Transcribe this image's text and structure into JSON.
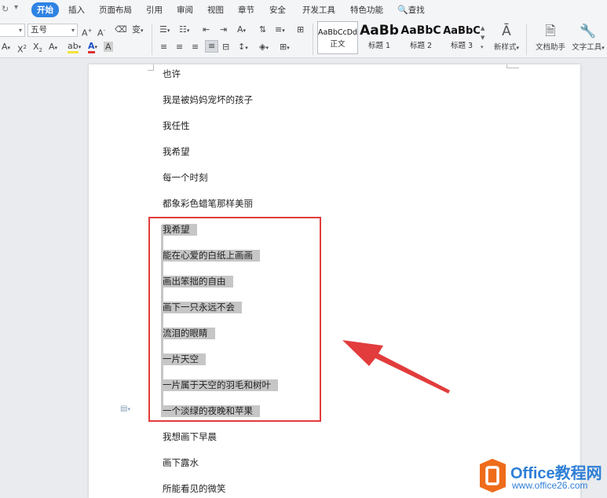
{
  "menubar": {
    "undo_icon": "↻",
    "quick_access_icon": "▾",
    "tabs": [
      "开始",
      "插入",
      "页面布局",
      "引用",
      "审阅",
      "视图",
      "章节",
      "安全",
      "开发工具",
      "特色功能"
    ],
    "search_label": "查找",
    "search_icon": "🔍"
  },
  "ribbon": {
    "font_size_value": "五号",
    "font_name_value": "",
    "styles": [
      {
        "preview": "AaBbCcDd",
        "label": "正文"
      },
      {
        "preview": "AaBb",
        "label": "标题 1"
      },
      {
        "preview": "AaBbC",
        "label": "标题 2"
      },
      {
        "preview": "AaBbC",
        "label": "标题 3"
      }
    ],
    "new_style_label": "新样式",
    "doc_helper_label": "文档助手",
    "text_tools_label": "文字工具",
    "accent_color": "#2f83e4"
  },
  "document": {
    "lines": [
      "也许",
      "我是被妈妈宠坏的孩子",
      "我任性",
      "我希望",
      "每一个时刻",
      "都象彩色蜡笔那样美丽",
      "我希望",
      "能在心爱的白纸上画画",
      "画出笨拙的自由",
      "画下一只永远不会",
      "流泪的眼睛",
      "一片天空",
      "一片属于天空的羽毛和树叶",
      "一个淡绿的夜晚和苹果",
      "我想画下早晨",
      "画下露水",
      "所能看见的微笑"
    ],
    "highlight_color": "#c6c6c6",
    "annotation_color": "#e23c3c"
  },
  "watermark": {
    "title": "Office教程网",
    "url": "www.office26.com",
    "logo_color": "#ef6c1b"
  }
}
